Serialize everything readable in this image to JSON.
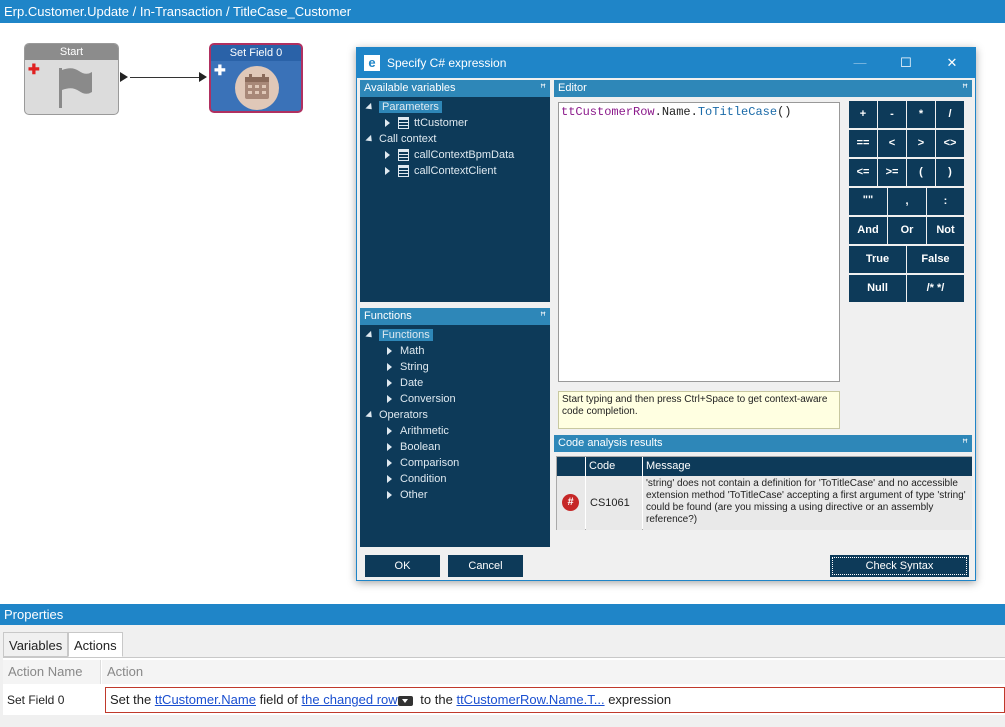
{
  "window": {
    "title": "Erp.Customer.Update / In-Transaction / TitleCase_Customer"
  },
  "workflow": {
    "start_node": {
      "label": "Start"
    },
    "set_field_node": {
      "label": "Set Field 0"
    }
  },
  "dialog": {
    "title": "Specify C# expression",
    "controls": {
      "minimize": "—",
      "maximize": "☐",
      "close": "✕"
    },
    "available_variables": {
      "header": "Available variables",
      "parameters_label": "Parameters",
      "tt_customer": "ttCustomer",
      "call_context_label": "Call context",
      "call_context_bpm_data": "callContextBpmData",
      "call_context_client": "callContextClient"
    },
    "functions": {
      "header": "Functions",
      "functions_label": "Functions",
      "math": "Math",
      "string": "String",
      "date": "Date",
      "conversion": "Conversion",
      "operators_label": "Operators",
      "arithmetic": "Arithmetic",
      "boolean": "Boolean",
      "comparison": "Comparison",
      "condition": "Condition",
      "other": "Other"
    },
    "editor": {
      "header": "Editor",
      "code_var": "ttCustomerRow",
      "code_dot1": ".",
      "code_name": "Name",
      "code_dot2": ".",
      "code_method": "ToTitleCase",
      "code_parens": "()",
      "hint": "Start typing and then press Ctrl+Space to get context-aware code completion."
    },
    "operators": [
      "+",
      "-",
      "*",
      "/",
      "==",
      "<",
      ">",
      "<>",
      "<=",
      ">=",
      "(",
      ")",
      "\"\"",
      ",",
      ":",
      "And",
      "Or",
      "Not",
      "True",
      "False",
      "Null",
      "/* */"
    ],
    "code_analysis": {
      "header": "Code analysis results",
      "col_code": "Code",
      "col_message": "Message",
      "error_symbol": "#",
      "row_code": "CS1061",
      "row_message": "'string' does not contain a definition for 'ToTitleCase' and no accessible extension method 'ToTitleCase' accepting a first argument of type 'string' could be found (are you missing a using directive or an assembly reference?)"
    },
    "ok_label": "OK",
    "cancel_label": "Cancel",
    "check_syntax_label": "Check Syntax",
    "pin_symbol": "ꟸ"
  },
  "properties": {
    "header": "Properties",
    "tabs": [
      "Variables",
      "Actions"
    ],
    "col_action_name": "Action Name",
    "col_action": "Action",
    "row_name": "Set Field 0",
    "action": {
      "set_the": "Set the",
      "field_link": "ttCustomer.Name",
      "field_of": "field of",
      "row_link": "the changed row",
      "to_the": "to the",
      "expr_link": "ttCustomerRow.Name.T...",
      "expression": "expression"
    }
  },
  "colors": {
    "accent": "#1f85c8",
    "panel": "#0d3a59",
    "error": "#c62828"
  }
}
